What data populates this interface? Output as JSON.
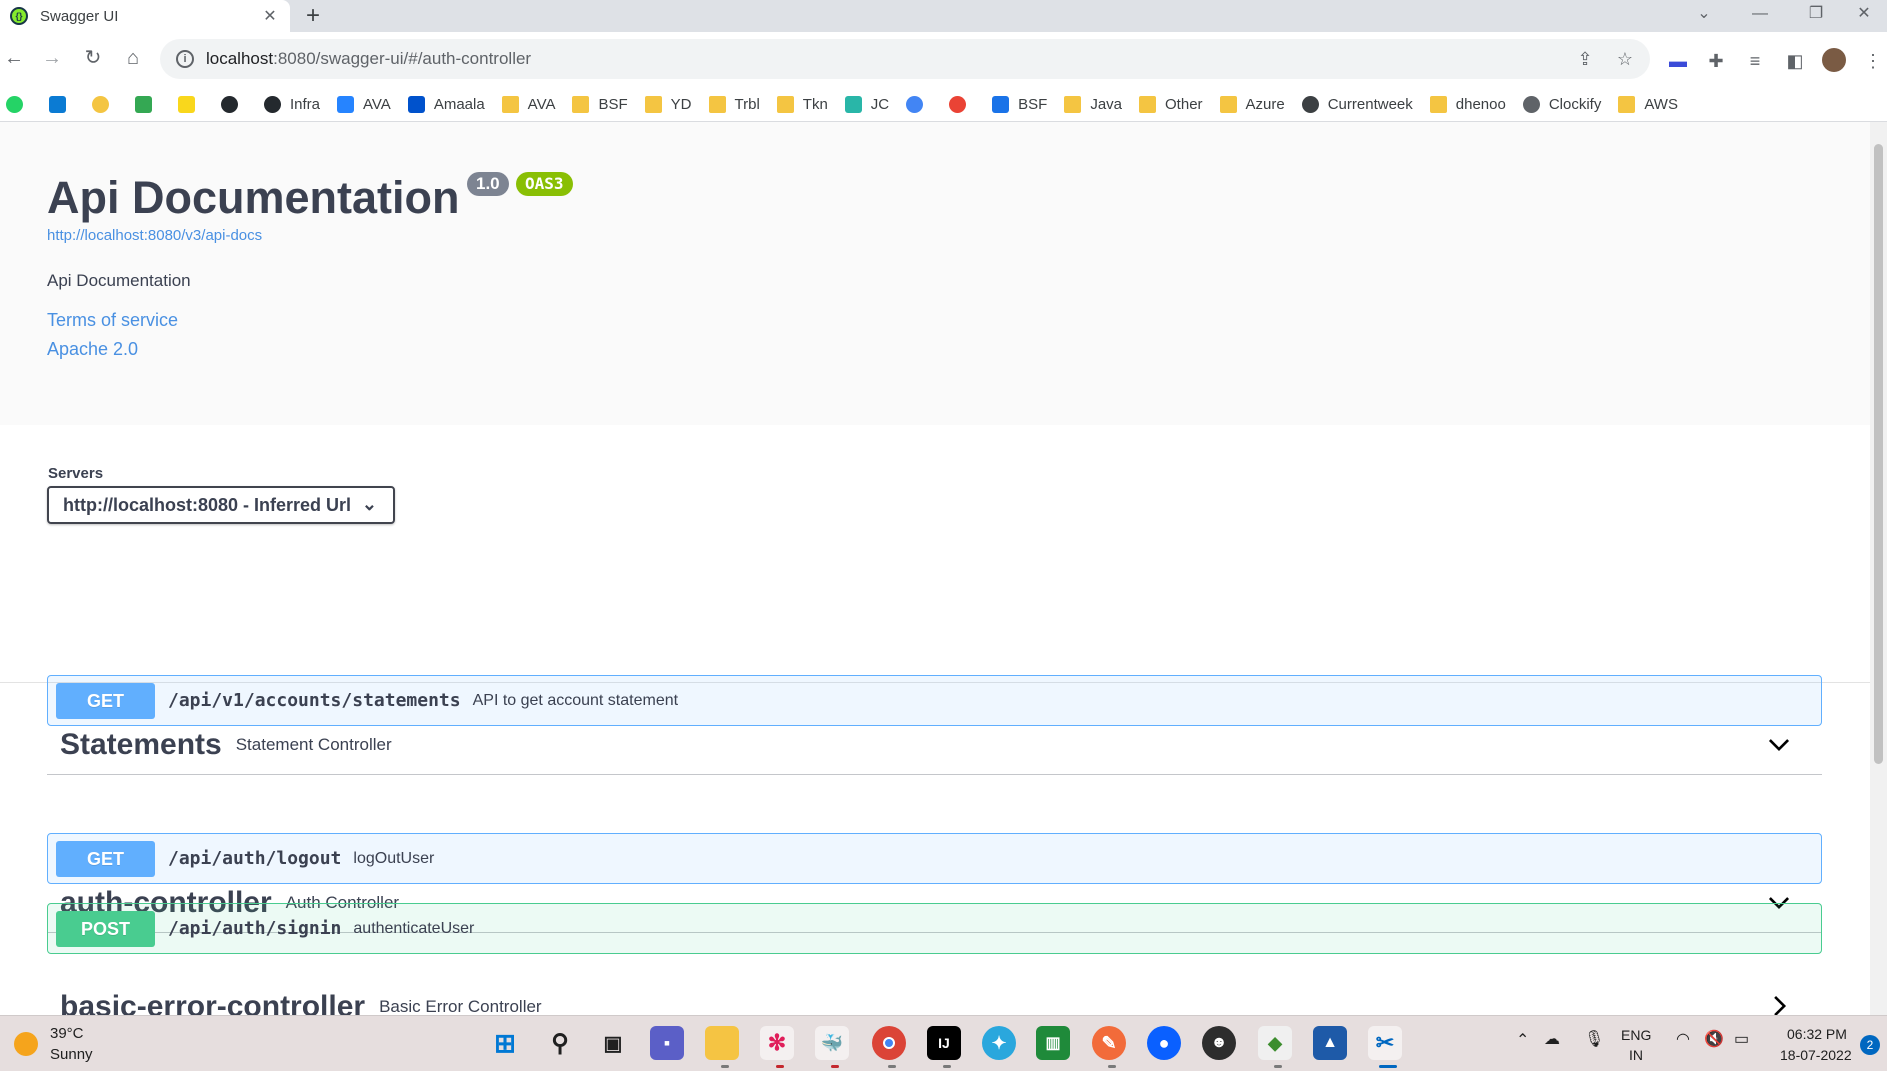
{
  "browser": {
    "tab_title": "Swagger UI",
    "url_host": "localhost",
    "url_rest": ":8080/swagger-ui/#/auth-controller",
    "bookmarks": [
      {
        "label": "",
        "color": "#25d366",
        "round": true
      },
      {
        "label": "",
        "color": "#0b7bd3",
        "round": false
      },
      {
        "label": "",
        "color": "#f4c542",
        "round": true
      },
      {
        "label": "",
        "color": "#34a853",
        "round": false
      },
      {
        "label": "",
        "color": "#f9d71c",
        "round": false
      },
      {
        "label": "",
        "color": "#24292e",
        "round": true
      },
      {
        "label": "Infra",
        "color": "#24292e",
        "round": true
      },
      {
        "label": "AVA",
        "color": "#2684ff",
        "round": false
      },
      {
        "label": "Amaala",
        "color": "#0052cc",
        "round": false
      },
      {
        "label": "AVA",
        "color": "folder"
      },
      {
        "label": "BSF",
        "color": "folder"
      },
      {
        "label": "YD",
        "color": "folder"
      },
      {
        "label": "Trbl",
        "color": "folder"
      },
      {
        "label": "Tkn",
        "color": "folder"
      },
      {
        "label": "JC",
        "color": "#29b6a8",
        "round": false
      },
      {
        "label": "",
        "color": "#4285f4",
        "round": true
      },
      {
        "label": "",
        "color": "#ea4335",
        "round": true
      },
      {
        "label": "BSF",
        "color": "#1a73e8",
        "round": false
      },
      {
        "label": "Java",
        "color": "folder"
      },
      {
        "label": "Other",
        "color": "folder"
      },
      {
        "label": "Azure",
        "color": "folder"
      },
      {
        "label": "Currentweek",
        "color": "#3c4043",
        "round": true
      },
      {
        "label": "dhenoo",
        "color": "folder"
      },
      {
        "label": "Clockify",
        "color": "#5f6368",
        "round": true
      },
      {
        "label": "AWS",
        "color": "folder"
      }
    ]
  },
  "info": {
    "title": "Api Documentation",
    "version": "1.0",
    "oas": "OAS3",
    "docs_url": "http://localhost:8080/v3/api-docs",
    "description": "Api Documentation",
    "terms": "Terms of service",
    "license": "Apache 2.0"
  },
  "servers": {
    "label": "Servers",
    "selected": "http://localhost:8080 - Inferred Url"
  },
  "sections": [
    {
      "name": "Statements",
      "description": "Statement Controller",
      "operations": [
        {
          "method": "GET",
          "path": "/api/v1/accounts/statements",
          "summary": "API to get account statement"
        }
      ]
    },
    {
      "name": "auth-controller",
      "description": "Auth Controller",
      "operations": [
        {
          "method": "GET",
          "path": "/api/auth/logout",
          "summary": "logOutUser"
        },
        {
          "method": "POST",
          "path": "/api/auth/signin",
          "summary": "authenticateUser"
        }
      ]
    },
    {
      "name": "basic-error-controller",
      "description": "Basic Error Controller",
      "operations": []
    }
  ],
  "taskbar": {
    "temperature": "39°C",
    "condition": "Sunny",
    "language": "ENG",
    "region": "IN",
    "time": "06:32 PM",
    "date": "18-07-2022",
    "notifications": "2"
  }
}
